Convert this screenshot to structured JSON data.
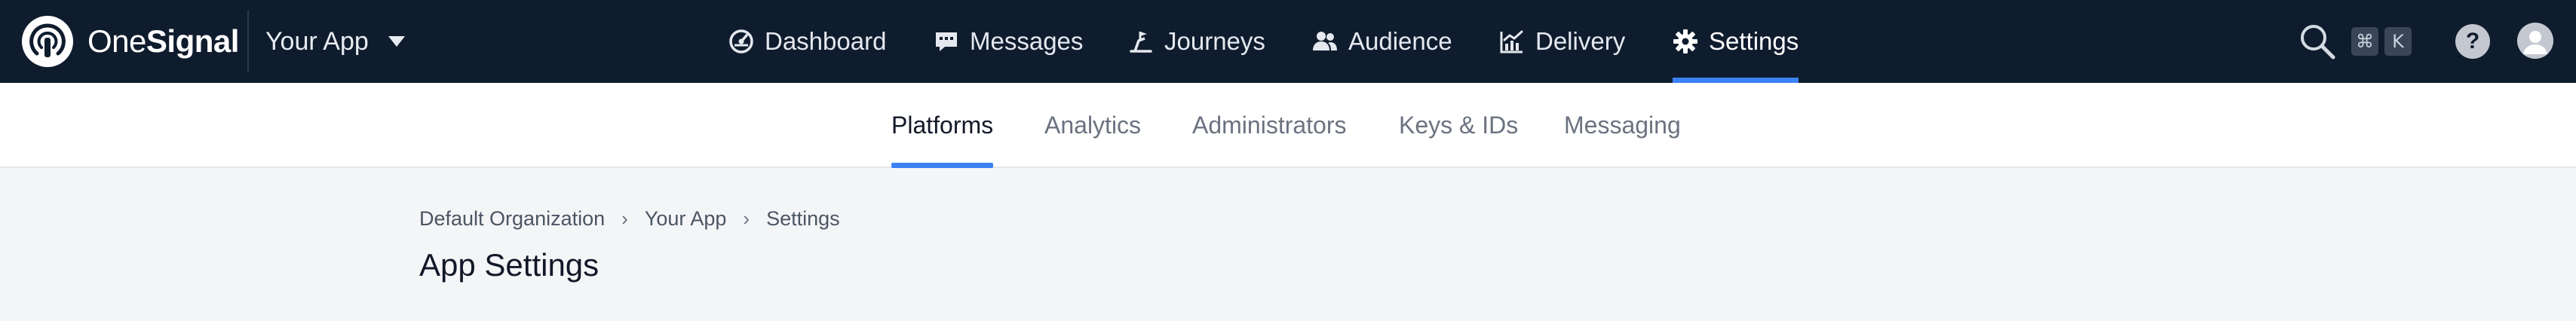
{
  "brand": {
    "one": "One",
    "signal": "Signal"
  },
  "app_switcher": {
    "label": "Your App"
  },
  "nav": {
    "items": [
      {
        "label": "Dashboard",
        "icon": "dashboard-icon",
        "active": false
      },
      {
        "label": "Messages",
        "icon": "message-icon",
        "active": false
      },
      {
        "label": "Journeys",
        "icon": "journeys-icon",
        "active": false
      },
      {
        "label": "Audience",
        "icon": "audience-icon",
        "active": false
      },
      {
        "label": "Delivery",
        "icon": "delivery-chart-icon",
        "active": false
      },
      {
        "label": "Settings",
        "icon": "gear-icon",
        "active": true
      }
    ]
  },
  "shortcut": {
    "cmd": "⌘",
    "key": "K"
  },
  "help": {
    "label": "?"
  },
  "subnav": {
    "tabs": [
      {
        "label": "Platforms",
        "active": true
      },
      {
        "label": "Analytics",
        "active": false
      },
      {
        "label": "Administrators",
        "active": false
      },
      {
        "label": "Keys & IDs",
        "active": false
      },
      {
        "label": "Messaging",
        "active": false
      }
    ]
  },
  "breadcrumb": {
    "items": [
      "Default Organization",
      "Your App",
      "Settings"
    ],
    "separator": "›"
  },
  "page": {
    "title": "App Settings"
  },
  "colors": {
    "topnav_bg": "#0f1c2e",
    "accent": "#3b82f6",
    "page_bg": "#f4f5f7",
    "subnav_bg": "#ffffff"
  }
}
